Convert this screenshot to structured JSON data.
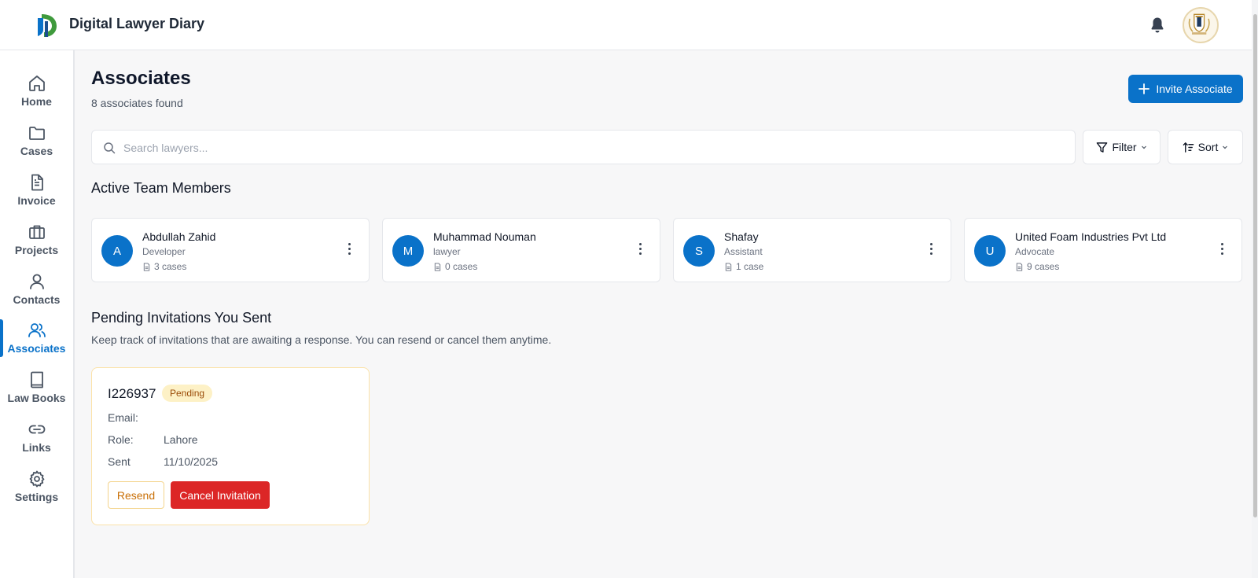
{
  "app": {
    "title": "Digital Lawyer Diary"
  },
  "sidebar": {
    "items": [
      {
        "label": "Home",
        "icon": "home-icon"
      },
      {
        "label": "Cases",
        "icon": "folder-icon"
      },
      {
        "label": "Invoice",
        "icon": "file-text-icon"
      },
      {
        "label": "Projects",
        "icon": "briefcase-icon"
      },
      {
        "label": "Contacts",
        "icon": "user-icon"
      },
      {
        "label": "Associates",
        "icon": "users-icon",
        "active": true
      },
      {
        "label": "Law Books",
        "icon": "book-icon"
      },
      {
        "label": "Links",
        "icon": "link-icon"
      },
      {
        "label": "Settings",
        "icon": "gear-icon"
      }
    ]
  },
  "page": {
    "title": "Associates",
    "subtitle": "8 associates found",
    "invite_button": "Invite Associate"
  },
  "search": {
    "placeholder": "Search lawyers..."
  },
  "toolbar": {
    "filter_label": "Filter",
    "sort_label": "Sort"
  },
  "active_section": {
    "heading": "Active Team Members",
    "members": [
      {
        "initial": "A",
        "name": "Abdullah Zahid",
        "role": "Developer",
        "cases": "3 cases"
      },
      {
        "initial": "M",
        "name": "Muhammad Nouman",
        "role": "lawyer",
        "cases": "0 cases"
      },
      {
        "initial": "S",
        "name": "Shafay",
        "role": "Assistant",
        "cases": "1 case"
      },
      {
        "initial": "U",
        "name": "United Foam Industries Pvt Ltd",
        "role": "Advocate",
        "cases": "9 cases"
      }
    ]
  },
  "pending_section": {
    "heading": "Pending Invitations You Sent",
    "description": "Keep track of invitations that are awaiting a response. You can resend or cancel them anytime.",
    "invitation": {
      "id": "I226937",
      "status": "Pending",
      "email_label": "Email:",
      "email_value": "",
      "role_label": "Role:",
      "role_value": "Lahore",
      "sent_label": "Sent",
      "sent_value": "11/10/2025",
      "resend_label": "Resend",
      "cancel_label": "Cancel Invitation"
    }
  },
  "colors": {
    "primary": "#0a72c9",
    "danger": "#dc2626",
    "pending_bg": "#fdf1c6",
    "pending_text": "#9a4a06",
    "resend_text": "#c96f06"
  }
}
